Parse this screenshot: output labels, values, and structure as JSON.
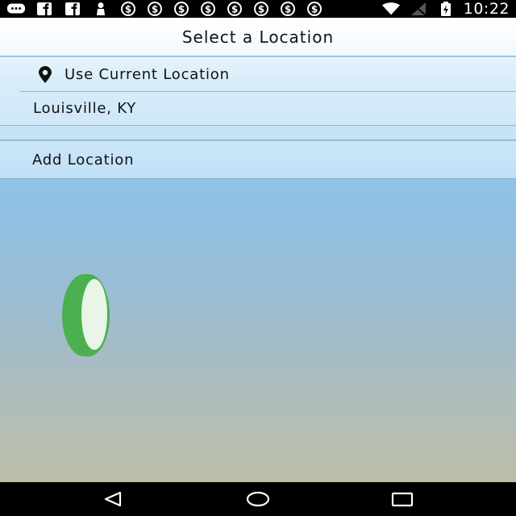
{
  "status_bar": {
    "time": "10:22",
    "notification_icons": [
      "messaging-icon",
      "facebook-icon",
      "facebook-icon",
      "person-icon",
      "dollar-icon",
      "dollar-icon",
      "dollar-icon",
      "dollar-icon",
      "dollar-icon",
      "dollar-icon",
      "dollar-icon",
      "dollar-icon"
    ],
    "system_icons": [
      "wifi-icon",
      "cell-signal-off-icon",
      "battery-charging-icon"
    ]
  },
  "header": {
    "title": "Select a Location"
  },
  "locations": {
    "current_location_label": "Use Current Location",
    "saved": [
      "Louisville, KY"
    ],
    "add_label": "Add Location"
  },
  "nav_bar": {
    "buttons": [
      "back-icon",
      "home-icon",
      "recents-icon"
    ]
  },
  "colors": {
    "accent_green": "#4caf50",
    "disc_face": "#e9f5e6"
  }
}
